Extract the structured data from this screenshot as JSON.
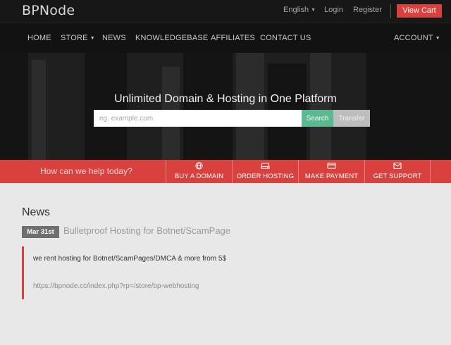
{
  "brand": "BPNode",
  "topbar": {
    "language": "English",
    "login": "Login",
    "register": "Register",
    "view_cart": "View Cart"
  },
  "nav": {
    "home": "HOME",
    "store": "STORE",
    "news": "NEWS",
    "knowledgebase": "KNOWLEDGEBASE",
    "affiliates": "AFFILIATES",
    "contact": "CONTACT US",
    "account": "ACCOUNT"
  },
  "hero": {
    "title": "Unlimited Domain & Hosting in One Platform",
    "search_placeholder": "eg. example.com",
    "search_button": "Search",
    "transfer_button": "Transfer"
  },
  "help": {
    "prompt": "How can we help today?",
    "buttons": [
      {
        "label": "BUY A DOMAIN",
        "icon": "globe-icon"
      },
      {
        "label": "ORDER HOSTING",
        "icon": "server-icon"
      },
      {
        "label": "MAKE PAYMENT",
        "icon": "credit-card-icon"
      },
      {
        "label": "GET SUPPORT",
        "icon": "envelope-icon"
      }
    ]
  },
  "news": {
    "heading": "News",
    "item": {
      "date": "Mar 31st",
      "title": "Bulletproof Hosting for Botnet/ScamPage",
      "text": "we rent hosting for Botnet/ScamPages/DMCA & more from 5$",
      "link": "https://bpnode.cc/index.php?rp=/store/bp-webhosting"
    }
  },
  "colors": {
    "accent": "#d9413f",
    "search": "#5cb88f",
    "dark": "#171717"
  }
}
